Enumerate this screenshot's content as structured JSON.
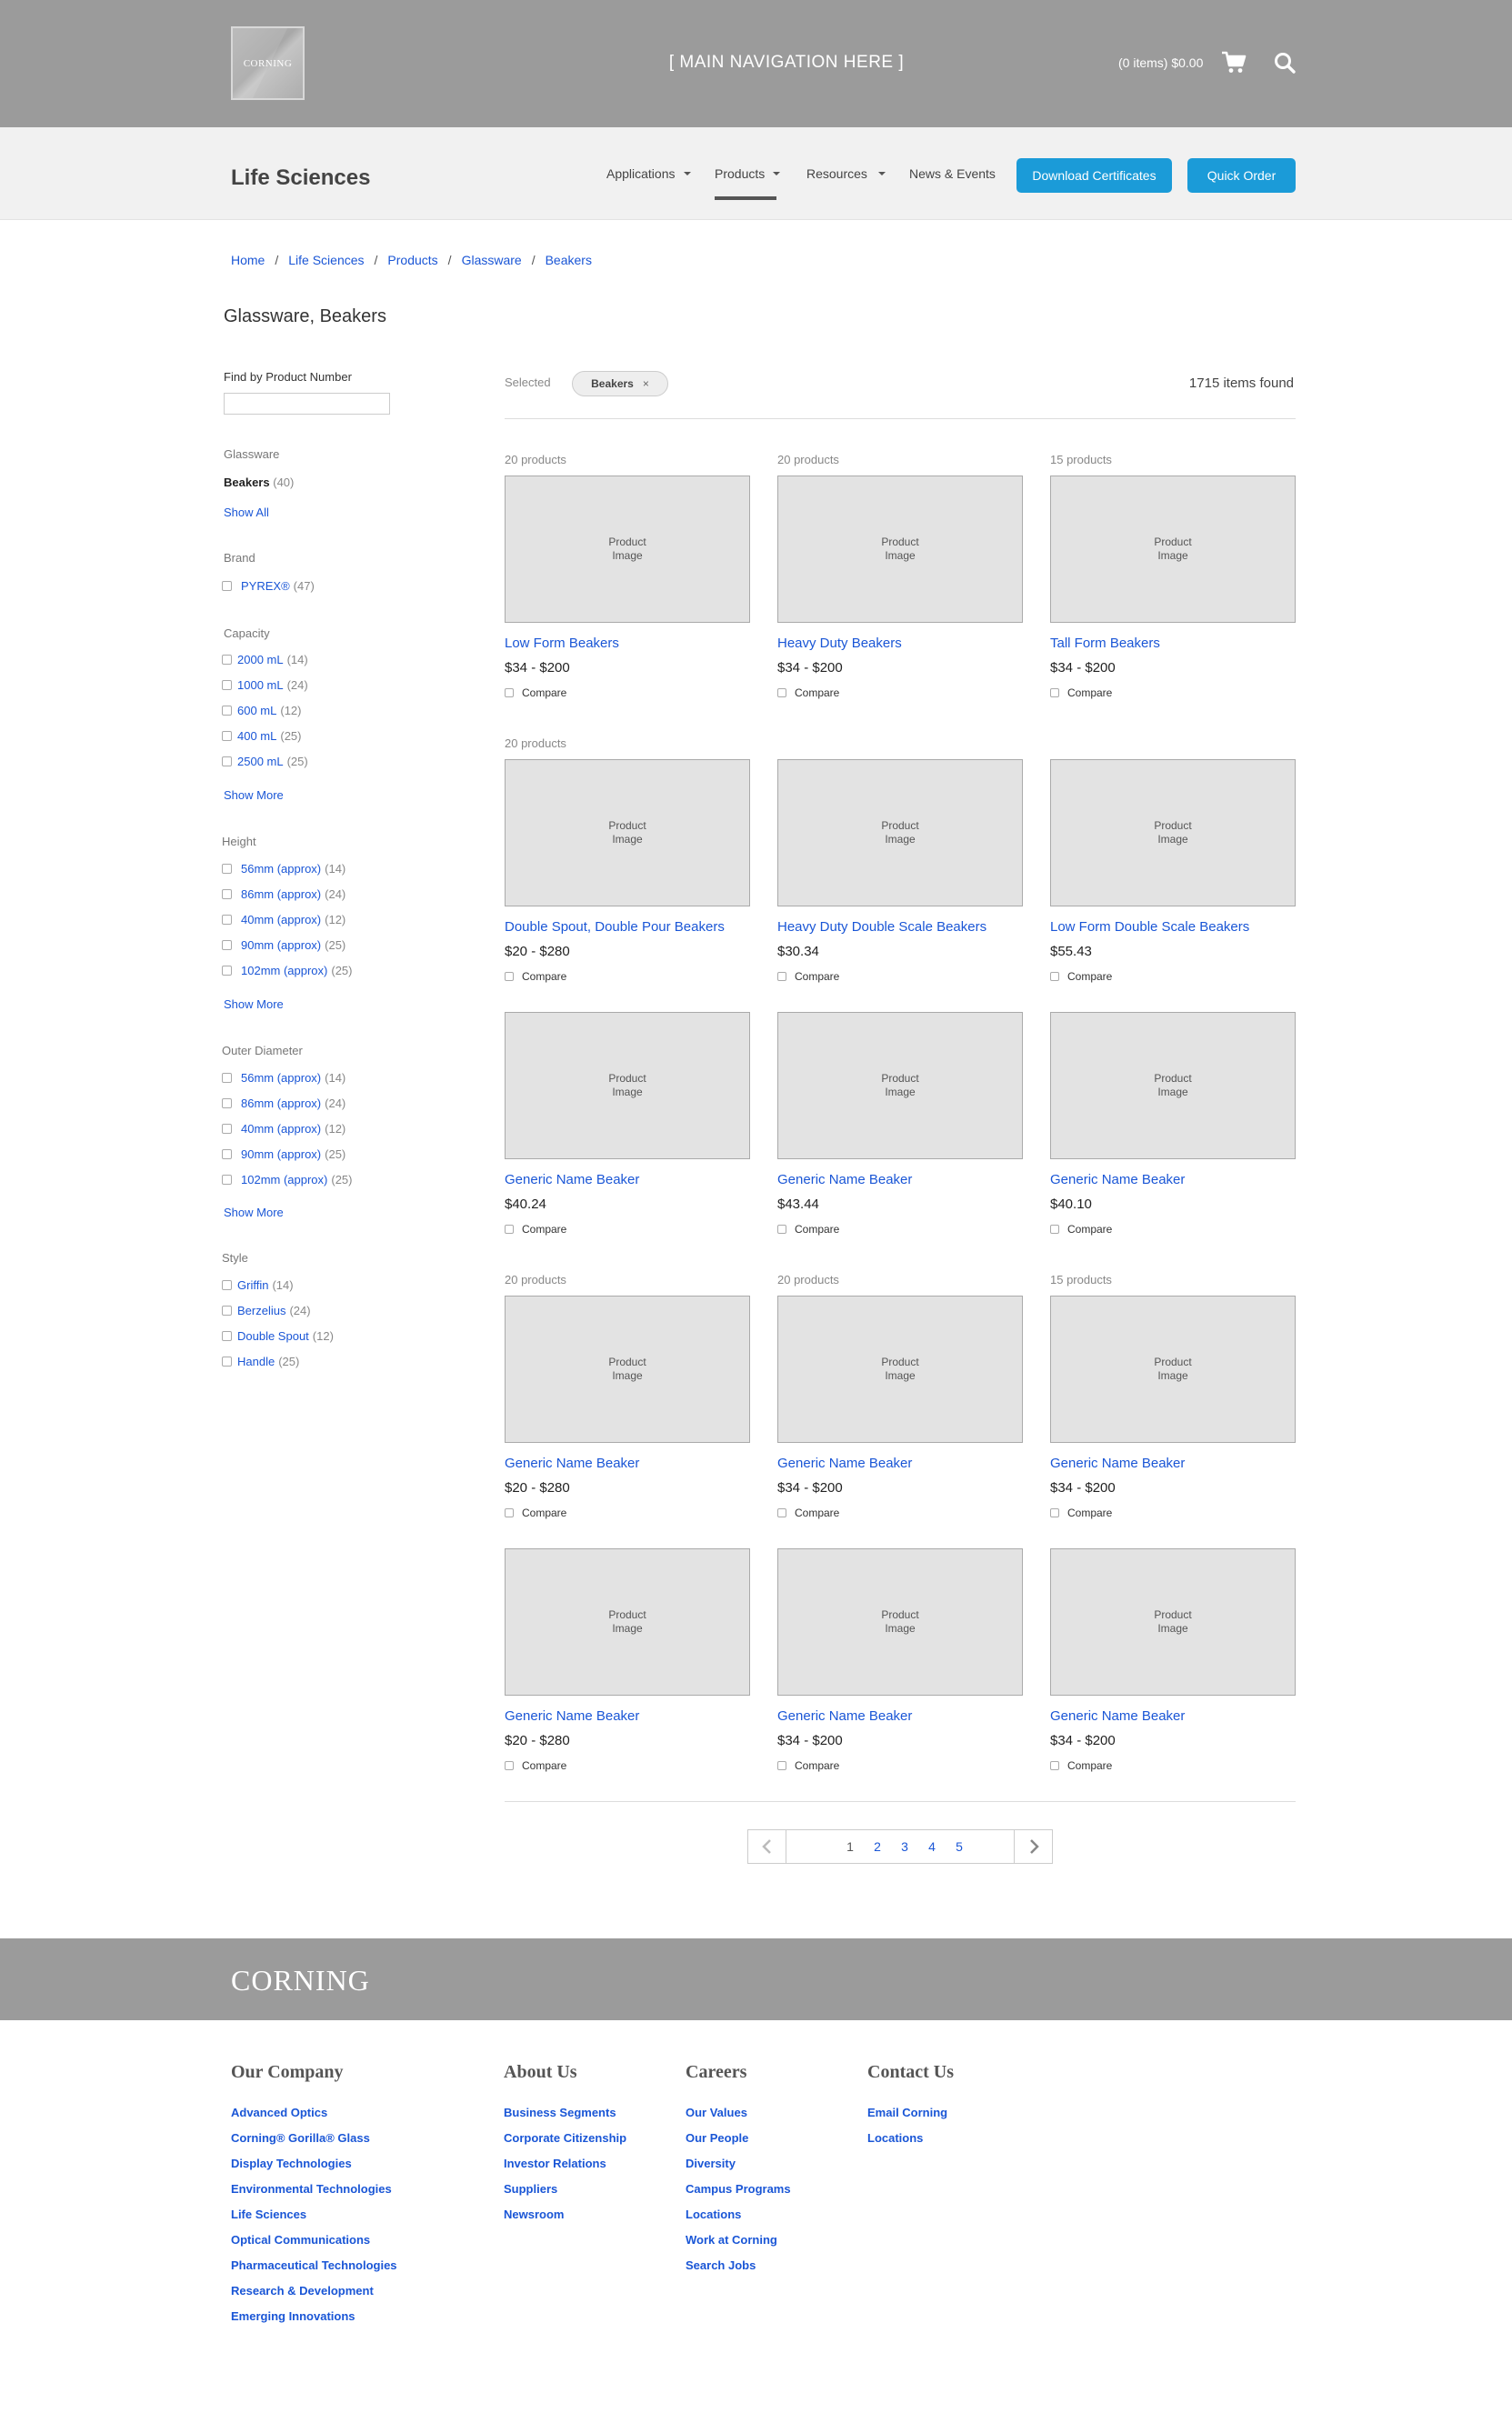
{
  "header": {
    "logo_text": "CORNING",
    "main_nav": "[ MAIN NAVIGATION HERE ]",
    "cart_text": "(0 items) $0.00"
  },
  "subheader": {
    "title": "Life Sciences",
    "nav": [
      "Applications",
      "Products",
      "Resources",
      "News & Events"
    ],
    "active_nav": "Products",
    "download_btn": "Download Certificates",
    "quick_order_btn": "Quick Order"
  },
  "breadcrumb": [
    "Home",
    "Life Sciences",
    "Products",
    "Glassware",
    "Beakers"
  ],
  "page_title": "Glassware, Beakers",
  "sidebar": {
    "find_label": "Find by Product Number",
    "glassware_label": "Glassware",
    "beakers_label": "Beakers",
    "beakers_count": "(40)",
    "show_all": "Show All",
    "brand_label": "Brand",
    "brand": [
      {
        "label": "PYREX®",
        "count": "(47)"
      }
    ],
    "capacity_label": "Capacity",
    "capacity": [
      {
        "label": "2000 mL",
        "count": "(14)"
      },
      {
        "label": "1000 mL",
        "count": "(24)"
      },
      {
        "label": "600 mL",
        "count": "(12)"
      },
      {
        "label": "400 mL",
        "count": "(25)"
      },
      {
        "label": "2500 mL",
        "count": "(25)"
      }
    ],
    "height_label": "Height",
    "height": [
      {
        "label": "56mm (approx)",
        "count": "(14)"
      },
      {
        "label": "86mm (approx)",
        "count": "(24)"
      },
      {
        "label": "40mm (approx)",
        "count": "(12)"
      },
      {
        "label": "90mm (approx)",
        "count": "(25)"
      },
      {
        "label": "102mm (approx)",
        "count": "(25)"
      }
    ],
    "outer_label": "Outer Diameter",
    "outer": [
      {
        "label": "56mm (approx)",
        "count": "(14)"
      },
      {
        "label": "86mm (approx)",
        "count": "(24)"
      },
      {
        "label": "40mm (approx)",
        "count": "(12)"
      },
      {
        "label": "90mm (approx)",
        "count": "(25)"
      },
      {
        "label": "102mm (approx)",
        "count": "(25)"
      }
    ],
    "style_label": "Style",
    "style": [
      {
        "label": "Griffin",
        "count": "(14)"
      },
      {
        "label": "Berzelius",
        "count": "(24)"
      },
      {
        "label": "Double Spout",
        "count": "(12)"
      },
      {
        "label": "Handle",
        "count": "(25)"
      }
    ],
    "show_more": "Show More"
  },
  "results": {
    "selected_label": "Selected",
    "chip": "Beakers",
    "chip_close": "×",
    "found": "1715 items found",
    "image_placeholder_line1": "Product",
    "image_placeholder_line2": "Image",
    "compare_label": "Compare",
    "products": [
      {
        "count": "20 products",
        "name": "Low Form Beakers",
        "price": "$34 - $200"
      },
      {
        "count": "20 products",
        "name": "Heavy Duty Beakers",
        "price": "$34 - $200"
      },
      {
        "count": "15 products",
        "name": "Tall Form Beakers",
        "price": "$34 - $200"
      },
      {
        "count": "20 products",
        "name": "Double Spout, Double Pour Beakers",
        "price": "$20 - $280"
      },
      {
        "count": "",
        "name": "Heavy Duty Double Scale Beakers",
        "price": "$30.34"
      },
      {
        "count": "",
        "name": "Low Form Double Scale Beakers",
        "price": "$55.43"
      },
      {
        "count": "",
        "name": "Generic Name Beaker",
        "price": "$40.24"
      },
      {
        "count": "",
        "name": "Generic Name Beaker",
        "price": "$43.44"
      },
      {
        "count": "",
        "name": "Generic Name Beaker",
        "price": "$40.10"
      },
      {
        "count": "20 products",
        "name": "Generic Name Beaker",
        "price": "$20 - $280"
      },
      {
        "count": "20 products",
        "name": "Generic Name Beaker",
        "price": "$34 - $200"
      },
      {
        "count": "15 products",
        "name": "Generic Name Beaker",
        "price": "$34 - $200"
      },
      {
        "count": "",
        "name": "Generic Name Beaker",
        "price": "$20 - $280"
      },
      {
        "count": "",
        "name": "Generic Name Beaker",
        "price": "$34 - $200"
      },
      {
        "count": "",
        "name": "Generic Name Beaker",
        "price": "$34 - $200"
      }
    ]
  },
  "pagination": {
    "pages": [
      "1",
      "2",
      "3",
      "4",
      "5"
    ],
    "current": "1"
  },
  "footer": {
    "logo": "CORNING",
    "columns": [
      {
        "title": "Our Company",
        "links": [
          "Advanced Optics",
          "Corning® Gorilla® Glass",
          "Display Technologies",
          "Environmental Technologies",
          "Life Sciences",
          "Optical Communications",
          "Pharmaceutical Technologies",
          "Research & Development",
          "Emerging Innovations"
        ]
      },
      {
        "title": "About Us",
        "links": [
          "Business Segments",
          "Corporate Citizenship",
          "Investor Relations",
          "Suppliers",
          "Newsroom"
        ]
      },
      {
        "title": "Careers",
        "links": [
          "Our Values",
          "Our People",
          "Diversity",
          "Campus Programs",
          "Locations",
          "Work at Corning",
          "Search Jobs"
        ]
      },
      {
        "title": "Contact Us",
        "links": [
          "Email Corning",
          "Locations"
        ]
      }
    ]
  },
  "colors": {
    "header_bg": "#9b9b9b",
    "subheader_bg": "#f1f1f1",
    "accent_button": "#1b9bd8",
    "link": "#1a56d6",
    "image_placeholder": "#e3e3e3"
  },
  "icons": [
    "cart-icon",
    "search-icon",
    "chevron-left-icon",
    "chevron-right-icon",
    "close-icon"
  ]
}
